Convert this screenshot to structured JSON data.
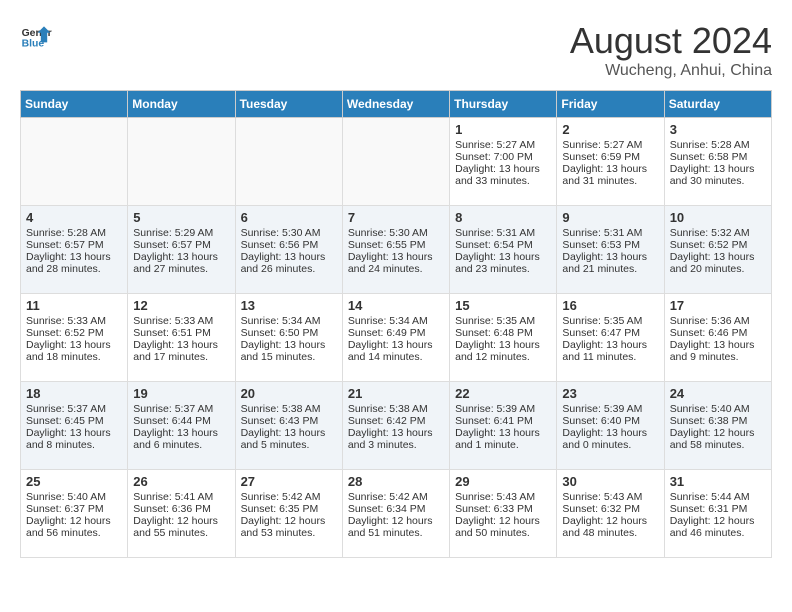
{
  "header": {
    "logo_line1": "General",
    "logo_line2": "Blue",
    "title": "August 2024",
    "subtitle": "Wucheng, Anhui, China"
  },
  "days_of_week": [
    "Sunday",
    "Monday",
    "Tuesday",
    "Wednesday",
    "Thursday",
    "Friday",
    "Saturday"
  ],
  "weeks": [
    [
      {
        "day": "",
        "content": ""
      },
      {
        "day": "",
        "content": ""
      },
      {
        "day": "",
        "content": ""
      },
      {
        "day": "",
        "content": ""
      },
      {
        "day": "1",
        "content": "Sunrise: 5:27 AM\nSunset: 7:00 PM\nDaylight: 13 hours\nand 33 minutes."
      },
      {
        "day": "2",
        "content": "Sunrise: 5:27 AM\nSunset: 6:59 PM\nDaylight: 13 hours\nand 31 minutes."
      },
      {
        "day": "3",
        "content": "Sunrise: 5:28 AM\nSunset: 6:58 PM\nDaylight: 13 hours\nand 30 minutes."
      }
    ],
    [
      {
        "day": "4",
        "content": "Sunrise: 5:28 AM\nSunset: 6:57 PM\nDaylight: 13 hours\nand 28 minutes."
      },
      {
        "day": "5",
        "content": "Sunrise: 5:29 AM\nSunset: 6:57 PM\nDaylight: 13 hours\nand 27 minutes."
      },
      {
        "day": "6",
        "content": "Sunrise: 5:30 AM\nSunset: 6:56 PM\nDaylight: 13 hours\nand 26 minutes."
      },
      {
        "day": "7",
        "content": "Sunrise: 5:30 AM\nSunset: 6:55 PM\nDaylight: 13 hours\nand 24 minutes."
      },
      {
        "day": "8",
        "content": "Sunrise: 5:31 AM\nSunset: 6:54 PM\nDaylight: 13 hours\nand 23 minutes."
      },
      {
        "day": "9",
        "content": "Sunrise: 5:31 AM\nSunset: 6:53 PM\nDaylight: 13 hours\nand 21 minutes."
      },
      {
        "day": "10",
        "content": "Sunrise: 5:32 AM\nSunset: 6:52 PM\nDaylight: 13 hours\nand 20 minutes."
      }
    ],
    [
      {
        "day": "11",
        "content": "Sunrise: 5:33 AM\nSunset: 6:52 PM\nDaylight: 13 hours\nand 18 minutes."
      },
      {
        "day": "12",
        "content": "Sunrise: 5:33 AM\nSunset: 6:51 PM\nDaylight: 13 hours\nand 17 minutes."
      },
      {
        "day": "13",
        "content": "Sunrise: 5:34 AM\nSunset: 6:50 PM\nDaylight: 13 hours\nand 15 minutes."
      },
      {
        "day": "14",
        "content": "Sunrise: 5:34 AM\nSunset: 6:49 PM\nDaylight: 13 hours\nand 14 minutes."
      },
      {
        "day": "15",
        "content": "Sunrise: 5:35 AM\nSunset: 6:48 PM\nDaylight: 13 hours\nand 12 minutes."
      },
      {
        "day": "16",
        "content": "Sunrise: 5:35 AM\nSunset: 6:47 PM\nDaylight: 13 hours\nand 11 minutes."
      },
      {
        "day": "17",
        "content": "Sunrise: 5:36 AM\nSunset: 6:46 PM\nDaylight: 13 hours\nand 9 minutes."
      }
    ],
    [
      {
        "day": "18",
        "content": "Sunrise: 5:37 AM\nSunset: 6:45 PM\nDaylight: 13 hours\nand 8 minutes."
      },
      {
        "day": "19",
        "content": "Sunrise: 5:37 AM\nSunset: 6:44 PM\nDaylight: 13 hours\nand 6 minutes."
      },
      {
        "day": "20",
        "content": "Sunrise: 5:38 AM\nSunset: 6:43 PM\nDaylight: 13 hours\nand 5 minutes."
      },
      {
        "day": "21",
        "content": "Sunrise: 5:38 AM\nSunset: 6:42 PM\nDaylight: 13 hours\nand 3 minutes."
      },
      {
        "day": "22",
        "content": "Sunrise: 5:39 AM\nSunset: 6:41 PM\nDaylight: 13 hours\nand 1 minute."
      },
      {
        "day": "23",
        "content": "Sunrise: 5:39 AM\nSunset: 6:40 PM\nDaylight: 13 hours\nand 0 minutes."
      },
      {
        "day": "24",
        "content": "Sunrise: 5:40 AM\nSunset: 6:38 PM\nDaylight: 12 hours\nand 58 minutes."
      }
    ],
    [
      {
        "day": "25",
        "content": "Sunrise: 5:40 AM\nSunset: 6:37 PM\nDaylight: 12 hours\nand 56 minutes."
      },
      {
        "day": "26",
        "content": "Sunrise: 5:41 AM\nSunset: 6:36 PM\nDaylight: 12 hours\nand 55 minutes."
      },
      {
        "day": "27",
        "content": "Sunrise: 5:42 AM\nSunset: 6:35 PM\nDaylight: 12 hours\nand 53 minutes."
      },
      {
        "day": "28",
        "content": "Sunrise: 5:42 AM\nSunset: 6:34 PM\nDaylight: 12 hours\nand 51 minutes."
      },
      {
        "day": "29",
        "content": "Sunrise: 5:43 AM\nSunset: 6:33 PM\nDaylight: 12 hours\nand 50 minutes."
      },
      {
        "day": "30",
        "content": "Sunrise: 5:43 AM\nSunset: 6:32 PM\nDaylight: 12 hours\nand 48 minutes."
      },
      {
        "day": "31",
        "content": "Sunrise: 5:44 AM\nSunset: 6:31 PM\nDaylight: 12 hours\nand 46 minutes."
      }
    ]
  ]
}
